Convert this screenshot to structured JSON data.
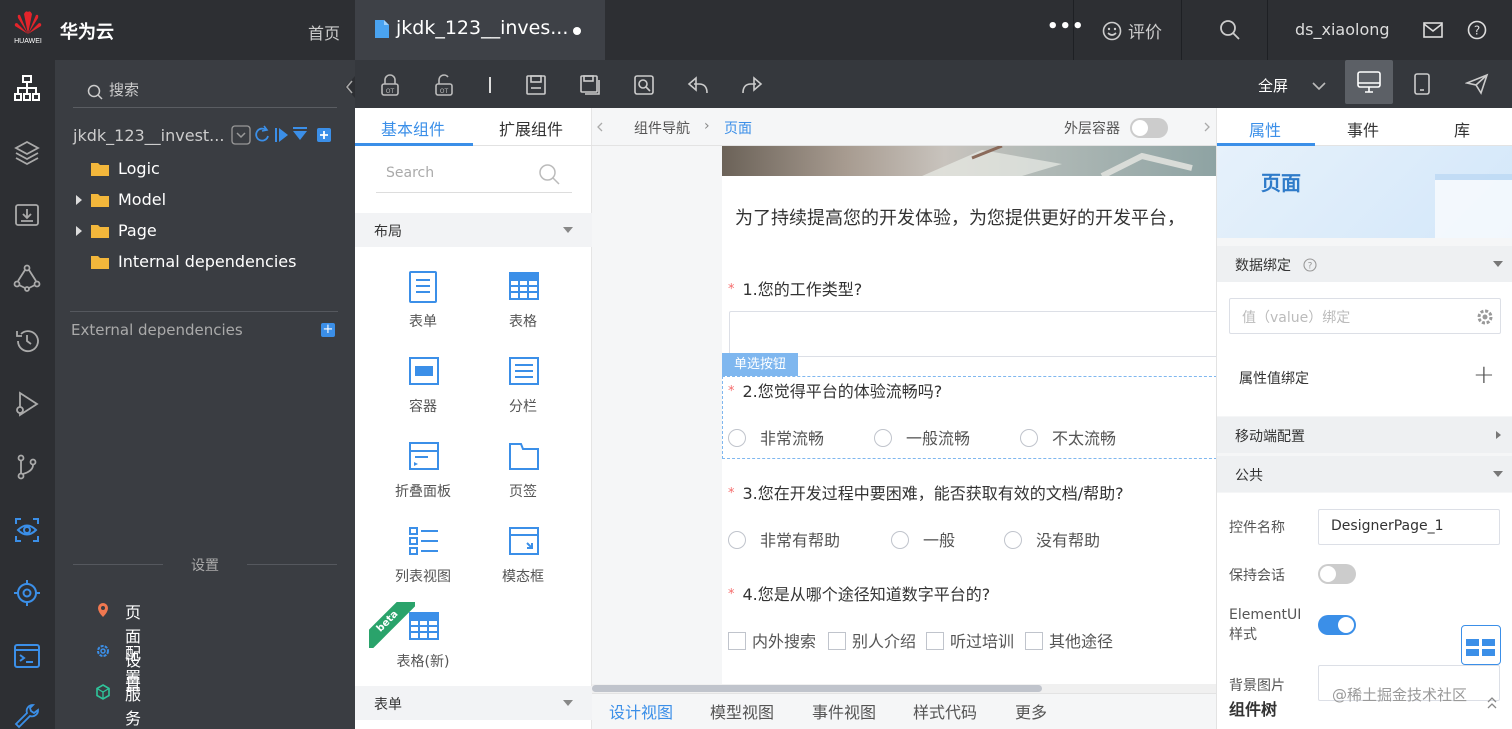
{
  "topbar": {
    "logo_text": "HUAWEI",
    "brand": "华为云",
    "home": "首页",
    "file_tab": "jkdk_123__inves...",
    "more": "•••",
    "rate": "评价",
    "user": "ds_xiaolong"
  },
  "tree": {
    "search_placeholder": "搜索",
    "project": "jkdk_123__invest...",
    "items": [
      {
        "label": "Logic",
        "expandable": false
      },
      {
        "label": "Model",
        "expandable": true
      },
      {
        "label": "Page",
        "expandable": true
      },
      {
        "label": "Internal dependencies",
        "expandable": false
      }
    ],
    "external": "External dependencies",
    "settings_label": "设置",
    "settings": [
      {
        "label": "页面设置",
        "icon": "location-pin-icon"
      },
      {
        "label": "配置",
        "icon": "gear-icon"
      },
      {
        "label": "服务",
        "icon": "cube-icon"
      }
    ]
  },
  "toolbar": {
    "fullscreen": "全屏"
  },
  "palette": {
    "tabs": [
      "基本组件",
      "扩展组件"
    ],
    "search_placeholder": "Search",
    "layout_section": "布局",
    "form_section": "表单",
    "components": [
      "表单",
      "表格",
      "容器",
      "分栏",
      "折叠面板",
      "页签",
      "列表视图",
      "模态框",
      "表格(新)"
    ],
    "beta": "beta"
  },
  "canvas": {
    "crumb_root": "组件导航",
    "crumb_current": "页面",
    "outer_container": "外层容器",
    "intro": "为了持续提高您的开发体验，为您提供更好的开发平台，",
    "selected_tag": "单选按钮",
    "q1": "1.您的工作类型?",
    "q2": "2.您觉得平台的体验流畅吗?",
    "q2_options": [
      "非常流畅",
      "一般流畅",
      "不太流畅"
    ],
    "q3": "3.您在开发过程中要困难，能否获取有效的文档/帮助?",
    "q3_options": [
      "非常有帮助",
      "一般",
      "没有帮助"
    ],
    "q4": "4.您是从哪个途径知道数字平台的?",
    "q4_options": [
      "内外搜索",
      "别人介绍",
      "听过培训",
      "其他途径"
    ],
    "bottom_tabs": [
      "设计视图",
      "模型视图",
      "事件视图",
      "样式代码",
      "更多"
    ]
  },
  "props": {
    "tabs": [
      "属性",
      "事件",
      "库"
    ],
    "hero_title": "页面",
    "data_binding": "数据绑定",
    "value_placeholder": "值（value）绑定",
    "attr_binding": "属性值绑定",
    "mobile_config": "移动端配置",
    "common": "公共",
    "ctrl_name_label": "控件名称",
    "ctrl_name_value": "DesignerPage_1",
    "keep_session": "保持会话",
    "elementui_style": "ElementUI样式",
    "bg_image": "背景图片",
    "component_tree": "组件树",
    "watermark": "@稀土掘金技术社区"
  },
  "colors": {
    "accent": "#3b8fe8",
    "dark": "#2d2f33",
    "required": "#f56c6c"
  }
}
